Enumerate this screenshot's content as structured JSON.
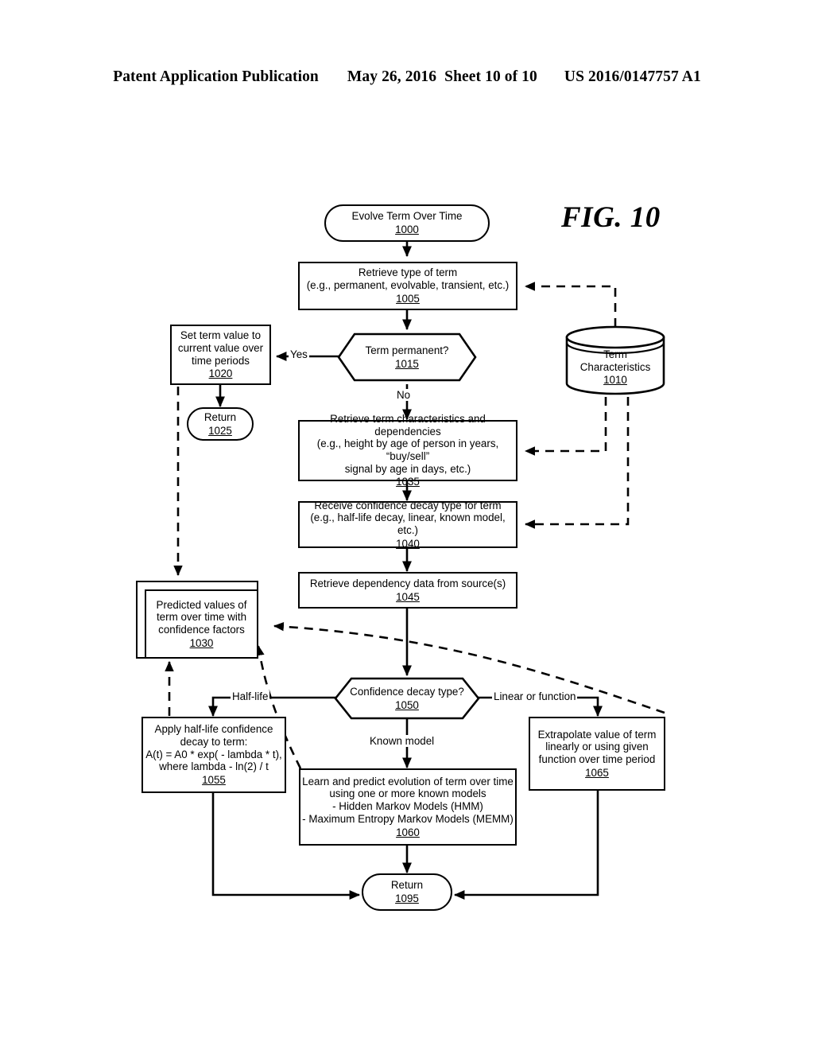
{
  "header": {
    "publication": "Patent Application Publication",
    "date": "May 26, 2016",
    "sheet": "Sheet 10 of 10",
    "patent_number": "US 2016/0147757 A1"
  },
  "figure": {
    "label": "FIG. 10"
  },
  "nodes": {
    "start_1000": {
      "text": "Evolve Term Over Time",
      "ref": "1000",
      "shape": "terminal"
    },
    "retrieve_type_1005": {
      "text": "Retrieve type of term\n(e.g., permanent, evolvable, transient, etc.)",
      "ref": "1005",
      "shape": "process"
    },
    "term_permanent_1015": {
      "text": "Term permanent?",
      "ref": "1015",
      "shape": "decision"
    },
    "term_characteristics_1010": {
      "text": "Term\nCharacteristics",
      "ref": "1010",
      "shape": "database"
    },
    "set_term_value_1020": {
      "text": "Set term value to\ncurrent value over\ntime periods",
      "ref": "1020",
      "shape": "process"
    },
    "return_1025": {
      "text": "Return",
      "ref": "1025",
      "shape": "terminal"
    },
    "retrieve_characteristics_1035": {
      "text": "Retrieve term characteristics and dependencies\n(e.g., height by age of person in years, “buy/sell”\nsignal by age in days, etc.)",
      "ref": "1035",
      "shape": "process"
    },
    "receive_decay_type_1040": {
      "text": "Receive confidence decay type for term\n(e.g., half-life decay, linear, known model, etc.)",
      "ref": "1040",
      "shape": "process"
    },
    "retrieve_dependency_1045": {
      "text": "Retrieve dependency data from source(s)",
      "ref": "1045",
      "shape": "process"
    },
    "predicted_values_1030": {
      "text": "Predicted values of\nterm over time with\nconfidence factors",
      "ref": "1030",
      "shape": "data-store"
    },
    "confidence_decay_type_1050": {
      "text": "Confidence decay type?",
      "ref": "1050",
      "shape": "decision"
    },
    "apply_half_life_1055": {
      "text": "Apply half-life confidence\ndecay to term:\nA(t) = A0 * exp( - lambda * t),\nwhere lambda - ln(2) / t",
      "ref": "1055",
      "shape": "process"
    },
    "learn_predict_1060": {
      "text": "Learn and predict evolution of term over time\nusing one or more known models\n- Hidden Markov Models (HMM)\n- Maximum Entropy Markov Models (MEMM)",
      "ref": "1060",
      "shape": "process"
    },
    "extrapolate_1065": {
      "text": "Extrapolate value of term\nlinearly or using given\nfunction over time period",
      "ref": "1065",
      "shape": "process"
    },
    "return_1095": {
      "text": "Return",
      "ref": "1095",
      "shape": "terminal"
    }
  },
  "edge_labels": {
    "yes": "Yes",
    "no": "No",
    "half_life": "Half-life",
    "known_model": "Known model",
    "linear_or_function": "Linear or function"
  },
  "colors": {
    "ink": "#000000",
    "paper": "#ffffff"
  }
}
